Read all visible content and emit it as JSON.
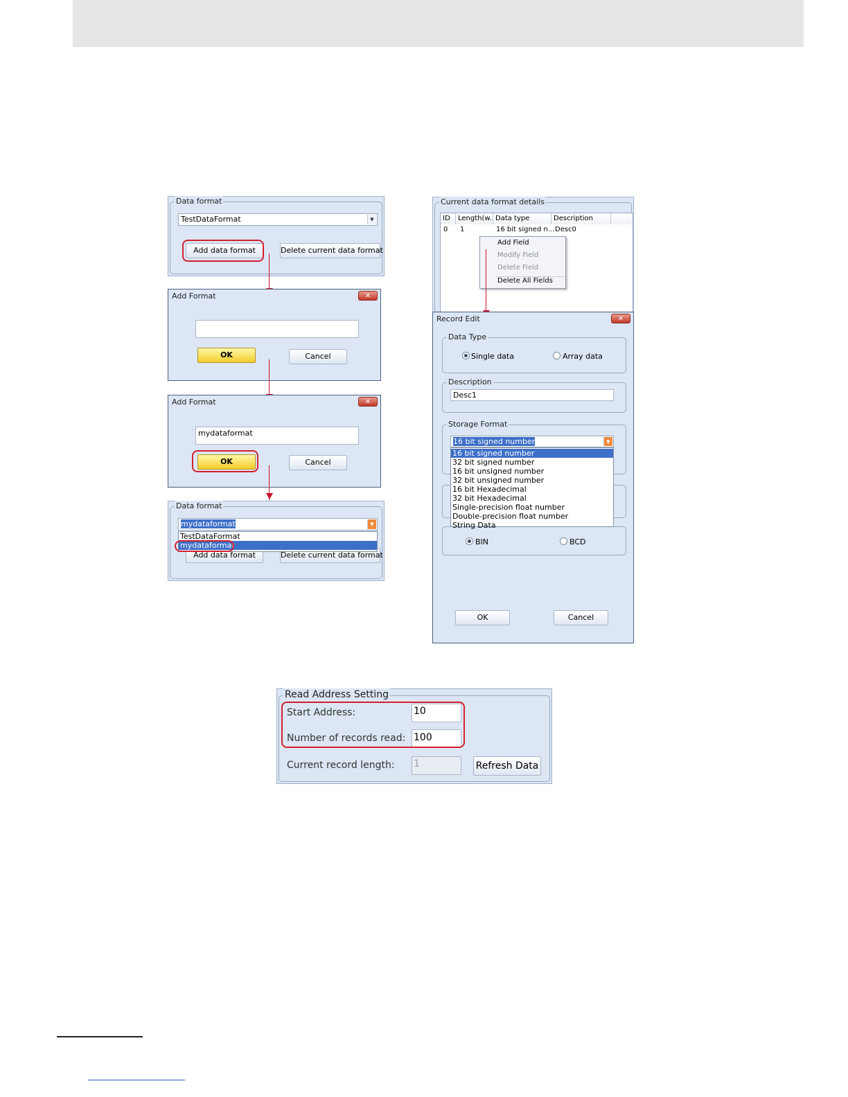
{
  "data_format_initial": {
    "group_label": "Data format",
    "combo_value": "TestDataFormat",
    "add_button": "Add data format",
    "delete_button": "Delete current data format"
  },
  "add_format_empty": {
    "title": "Add Format",
    "input_value": "",
    "ok_button": "OK",
    "cancel_button": "Cancel"
  },
  "add_format_filled": {
    "title": "Add Format",
    "input_value": "mydataformat",
    "ok_button": "OK",
    "cancel_button": "Cancel"
  },
  "data_format_final": {
    "group_label": "Data format",
    "combo_value": "mydataformat",
    "options": [
      "TestDataFormat",
      "mydataformat"
    ],
    "add_button": "Add data format",
    "delete_button": "Delete current data format"
  },
  "details": {
    "group_label": "Current data format details",
    "columns": [
      "ID",
      "Length(w...",
      "Data type",
      "Description"
    ],
    "rows": [
      [
        "0",
        "1",
        "16 bit signed n...",
        "Desc0"
      ]
    ],
    "context_menu": {
      "items": [
        "Add Field",
        "Modify Field",
        "Delete Field",
        "Delete All Fields"
      ],
      "disabled": [
        false,
        true,
        true,
        false
      ]
    }
  },
  "record_edit": {
    "title": "Record Edit",
    "data_type_label": "Data Type",
    "single_data": "Single data",
    "array_data": "Array data",
    "description_label": "Description",
    "description_value": "Desc1",
    "storage_format_label": "Storage Format",
    "storage_selected": "16 bit signed number",
    "storage_options": [
      "16 bit signed number",
      "32 bit signed number",
      "16 bit unsigned number",
      "32 bit unsigned number",
      "16 bit Hexadecimal",
      "32 bit Hexadecimal",
      "Single-precision float number",
      "Double-precision float number",
      "String Data"
    ],
    "bin": "BIN",
    "bcd": "BCD",
    "ok_button": "OK",
    "cancel_button": "Cancel"
  },
  "read_address": {
    "group_label": "Read Address Setting",
    "start_address_label": "Start Address:",
    "start_address_value": "10",
    "records_label": "Number of records read:",
    "records_value": "100",
    "record_length_label": "Current record length:",
    "record_length_value": "1",
    "refresh_button": "Refresh Data"
  },
  "colors": {
    "panel_bg": "#dce6f4",
    "highlight_red": "#d2202f",
    "selection_blue": "#3d6fc8",
    "ok_yellow": "#f2cd2a"
  }
}
